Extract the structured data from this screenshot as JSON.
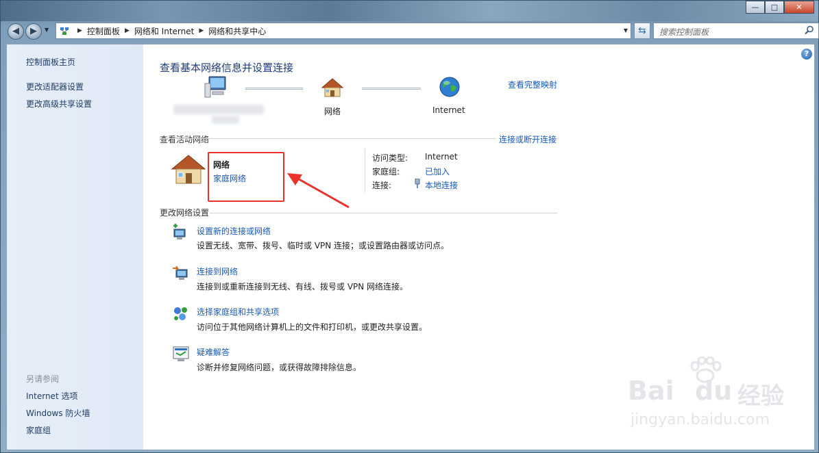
{
  "window": {
    "controls": {
      "minimize": "—",
      "maximize": "□",
      "close": "✕"
    }
  },
  "address": {
    "breadcrumbs": [
      "控制面板",
      "网络和 Internet",
      "网络和共享中心"
    ],
    "search_placeholder": "搜索控制面板"
  },
  "sidebar": {
    "items": [
      "控制面板主页",
      "更改适配器设置",
      "更改高级共享设置"
    ],
    "see_also_heading": "另请参阅",
    "see_also": [
      "Internet 选项",
      "Windows 防火墙",
      "家庭组"
    ]
  },
  "main": {
    "title": "查看基本网络信息并设置连接",
    "view_full_map": "查看完整映射",
    "map_nodes": {
      "network": "网络",
      "internet": "Internet"
    },
    "active_heading": "查看活动网络",
    "connect_disconnect": "连接或断开连接",
    "active_network": {
      "name": "网络",
      "type": "家庭网络",
      "access_type_label": "访问类型:",
      "access_type_value": "Internet",
      "homegroup_label": "家庭组:",
      "homegroup_value": "已加入",
      "connections_label": "连接:",
      "connections_value": "本地连接"
    },
    "change_heading": "更改网络设置",
    "tasks": [
      {
        "title": "设置新的连接或网络",
        "desc": "设置无线、宽带、拨号、临时或 VPN 连接；或设置路由器或访问点。"
      },
      {
        "title": "连接到网络",
        "desc": "连接到或重新连接到无线、有线、拨号或 VPN 网络连接。"
      },
      {
        "title": "选择家庭组和共享选项",
        "desc": "访问位于其他网络计算机上的文件和打印机，或更改共享设置。"
      },
      {
        "title": "疑难解答",
        "desc": "诊断并修复网络问题，或获得故障排除信息。"
      }
    ]
  },
  "watermark": {
    "brand": "Bai",
    "brand2": "du",
    "cn": "经验",
    "url": "jingyan.baidu.com"
  },
  "colors": {
    "link": "#1a59b5",
    "highlight": "#e8322b",
    "sidebar": "#e3ecf7"
  }
}
